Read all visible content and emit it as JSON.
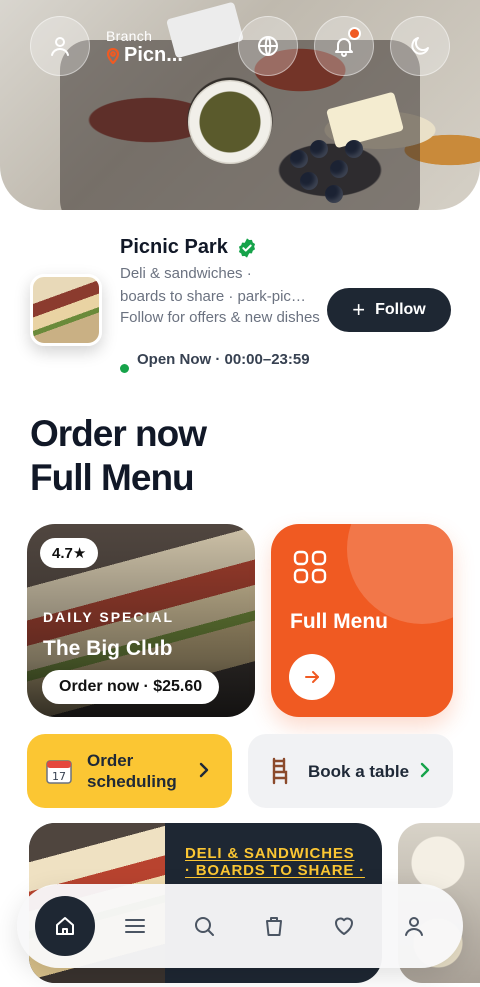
{
  "hero": {
    "branch_label": "Branch",
    "branch_value": "Picn...",
    "icons": [
      "user-icon",
      "globe-icon",
      "bell-icon",
      "moon-icon"
    ]
  },
  "store": {
    "name": "Picnic Park",
    "desc_line1": "Deli & sandwiches ·",
    "desc_line2": "boards to share · park-picnic",
    "desc_line3": "Follow for offers & new dishes",
    "open_status": "Open Now · 00:00–23:59",
    "follow_label": "Follow"
  },
  "headline": {
    "line1": "Order now",
    "line2": "Full Menu"
  },
  "special": {
    "rating": "4.7★",
    "label": "DAILY SPECIAL",
    "name": "The Big Club",
    "order_label": "Order now · $25.60"
  },
  "menu_card": {
    "title": "Full Menu"
  },
  "quick": {
    "schedule_label": "Order scheduling",
    "book_label": "Book a table"
  },
  "promo": {
    "text": "DELI & SANDWICHES · BOARDS TO SHARE ·"
  },
  "nav": {
    "items": [
      "home-icon",
      "menu-icon",
      "search-icon",
      "bag-icon",
      "heart-icon",
      "profile-icon"
    ],
    "active": "home-icon"
  },
  "colors": {
    "accent": "#f05a22",
    "dark": "#1e2733",
    "yellow": "#fbc633",
    "green": "#16a34a"
  }
}
